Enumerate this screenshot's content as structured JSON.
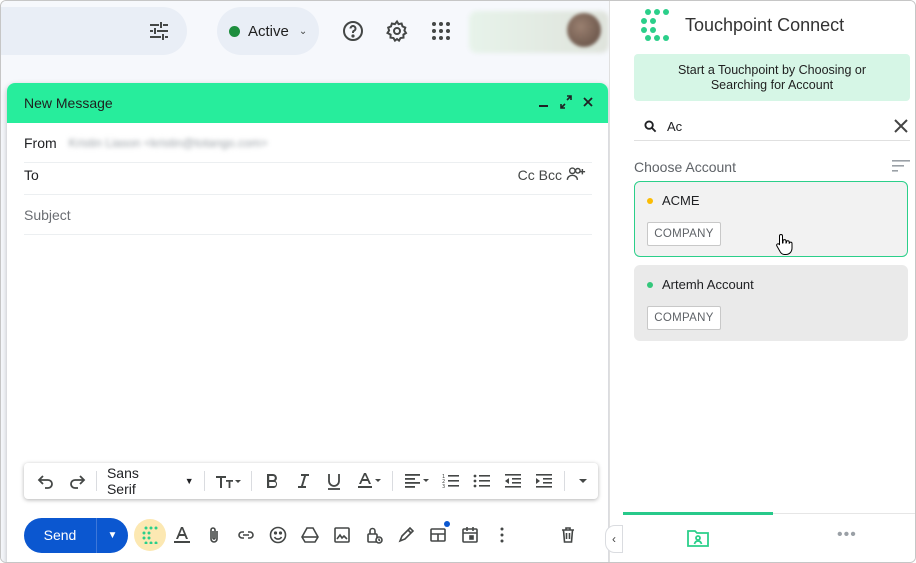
{
  "topbar": {
    "status_label": "Active"
  },
  "compose": {
    "title": "New Message",
    "from_label": "From",
    "from_value": "Kristin Liason <kristin@totango.com>",
    "to_label": "To",
    "cc_bcc": "Cc Bcc",
    "subject_placeholder": "Subject",
    "font_family": "Sans Serif",
    "send_label": "Send"
  },
  "panel": {
    "title": "Touchpoint Connect",
    "banner": "Start a Touchpoint by Choosing or Searching for Account",
    "search_value": "Ac",
    "section_title": "Choose Account",
    "accounts": [
      {
        "name": "ACME",
        "type": "COMPANY",
        "dot_color": "#fbbc04"
      },
      {
        "name": "Artemh Account",
        "type": "COMPANY",
        "dot_color": "#34c77b"
      }
    ],
    "footer_more": "•••"
  },
  "colors": {
    "compose_header": "#27ed9c",
    "send_button": "#0b57d0",
    "banner_bg": "#d6f6e6",
    "accent_green": "#2bcf8a"
  }
}
